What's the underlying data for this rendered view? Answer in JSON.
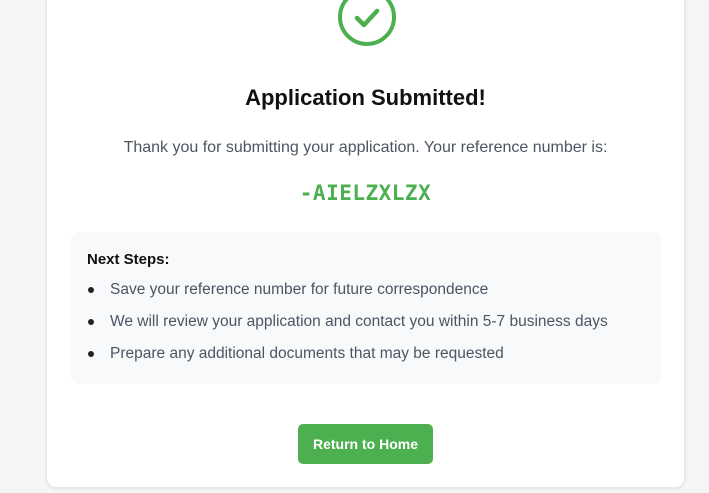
{
  "colors": {
    "accent": "#4caf50",
    "text_primary": "#111111",
    "text_secondary": "#4b5563",
    "panel_bg": "#f8f9fa"
  },
  "header": {
    "icon": "check-circle-icon",
    "title": "Application Submitted!"
  },
  "message": {
    "text": "Thank you for submitting your application. Your reference number is:",
    "reference_number": "-AIELZXLZX"
  },
  "next_steps": {
    "title": "Next Steps:",
    "items": [
      "Save your reference number for future correspondence",
      "We will review your application and contact you within 5-7 business days",
      "Prepare any additional documents that may be requested"
    ]
  },
  "actions": {
    "return_home_label": "Return to Home"
  }
}
